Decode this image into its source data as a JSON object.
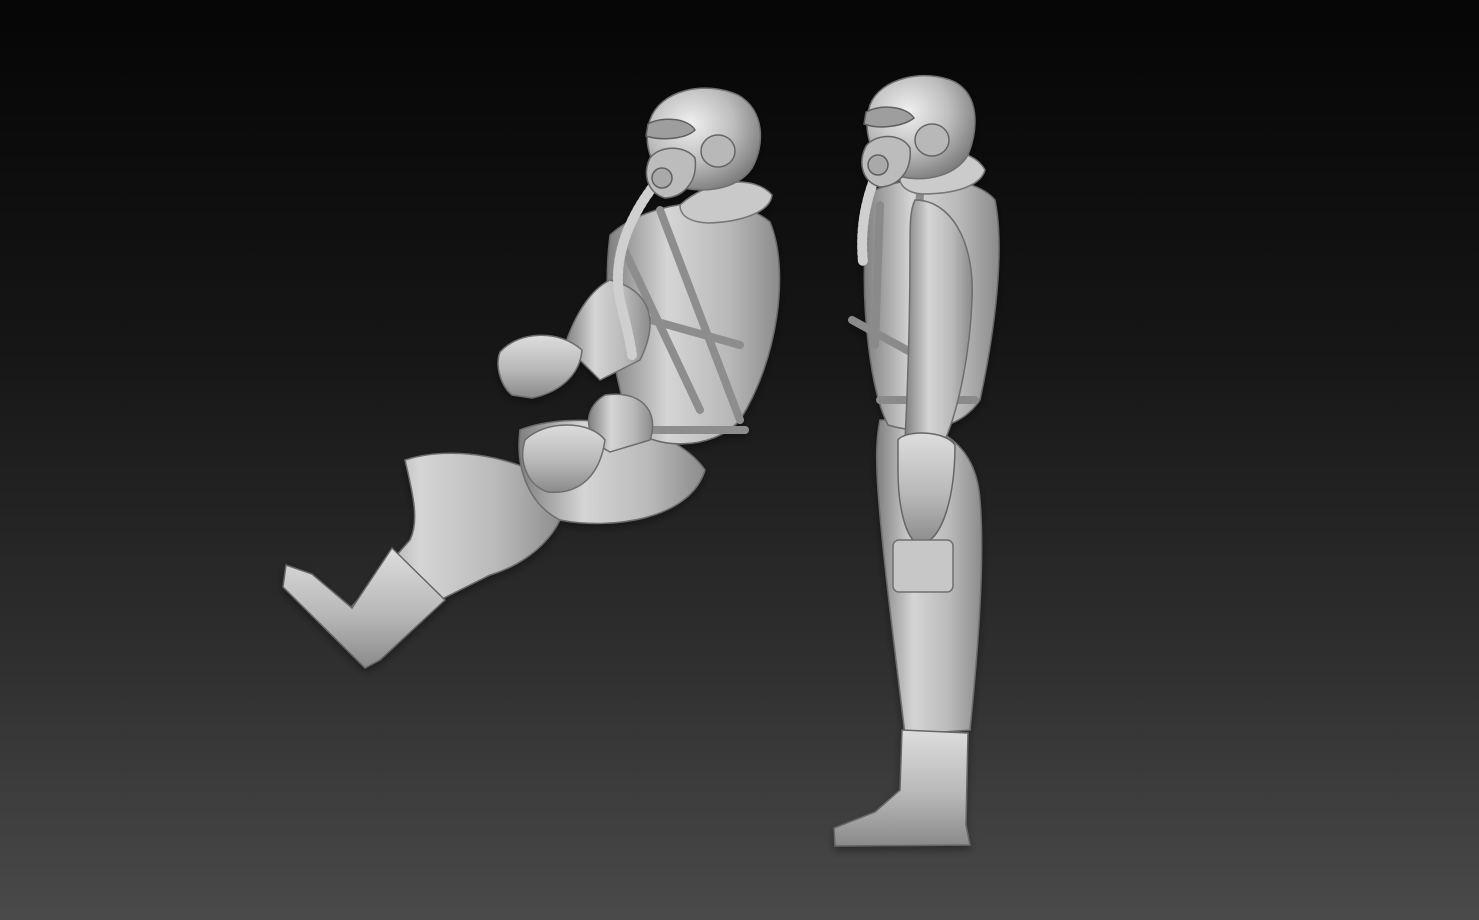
{
  "scene": {
    "description_visible_text": "",
    "background": {
      "top": "#050505",
      "bottom": "#4a4a4a"
    },
    "material_color": "#bdbdbd"
  },
  "figures": [
    {
      "name": "seated-pilot-figure",
      "pose": "seated"
    },
    {
      "name": "standing-pilot-figure",
      "pose": "standing"
    }
  ]
}
